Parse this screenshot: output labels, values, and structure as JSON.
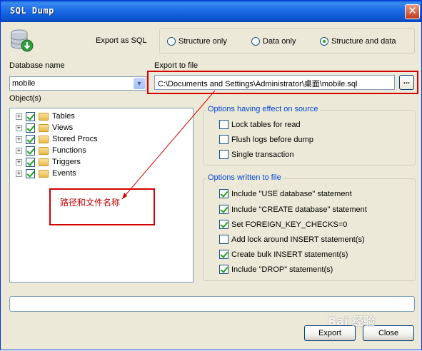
{
  "window": {
    "title": "SQL Dump",
    "close_glyph": "✕"
  },
  "export_as": {
    "label": "Export as SQL",
    "options": [
      "Structure only",
      "Data only",
      "Structure and data"
    ],
    "selected": "Structure and data"
  },
  "database": {
    "label": "Database name",
    "value": "mobile"
  },
  "export_file": {
    "label": "Export to file",
    "value": "C:\\Documents and Settings\\Administrator\\桌面\\mobile.sql",
    "browse_label": "..."
  },
  "objects": {
    "label": "Object(s)",
    "items": [
      "Tables",
      "Views",
      "Stored Procs",
      "Functions",
      "Triggers",
      "Events"
    ]
  },
  "source_options": {
    "title": "Options having effect on source",
    "items": [
      {
        "label": "Lock tables for read",
        "checked": false
      },
      {
        "label": "Flush logs before dump",
        "checked": false
      },
      {
        "label": "Single transaction",
        "checked": false
      }
    ]
  },
  "written_options": {
    "title": "Options written to file",
    "items": [
      {
        "label": "Include \"USE database\" statement",
        "checked": true
      },
      {
        "label": "Include \"CREATE database\" statement",
        "checked": true
      },
      {
        "label": "Set FOREIGN_KEY_CHECKS=0",
        "checked": true
      },
      {
        "label": "Add lock around INSERT statement(s)",
        "checked": false
      },
      {
        "label": "Create bulk INSERT statement(s)",
        "checked": true
      },
      {
        "label": "Include \"DROP\" statement(s)",
        "checked": true
      }
    ]
  },
  "buttons": {
    "export": "Export",
    "close": "Close"
  },
  "annotation": {
    "text": "路径和文件名称"
  },
  "watermark": {
    "text": "Bai 经验"
  },
  "colors": {
    "annotation_red": "#d40000",
    "title_blue": "#0a55d0",
    "group_title": "#0046d5"
  }
}
